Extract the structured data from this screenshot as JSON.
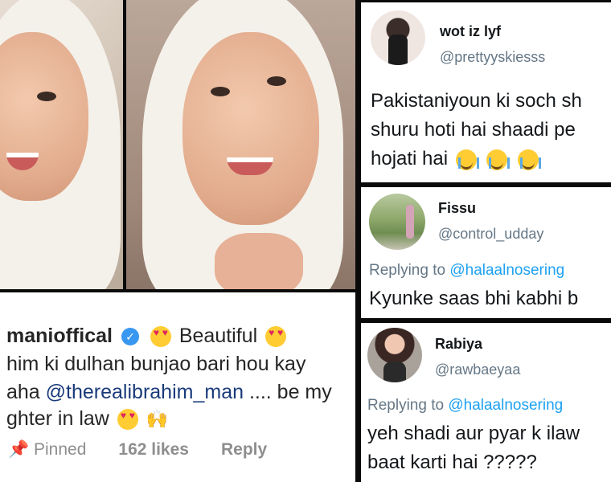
{
  "instagram_comment": {
    "username": "manioffical",
    "text_line1_suffix": "Beautiful",
    "text_line2": "him ki dulhan bunjao bari hou kay",
    "text_line3_prefix": "aha",
    "mention": "@therealibrahim_man",
    "text_line3_suffix": ".... be my",
    "text_line4": "ghter in law",
    "pinned_label": "Pinned",
    "likes_label": "162 likes",
    "reply_label": "Reply"
  },
  "tweets": [
    {
      "name": "wot iz lyf",
      "handle": "@prettyyskiesss",
      "replying_prefix": "",
      "replying_mention": "",
      "lines": [
        "Pakistaniyoun ki soch sh",
        "shuru hoti hai shaadi pe",
        "hojati hai"
      ]
    },
    {
      "name": "Fissu",
      "handle": "@control_udday",
      "replying_prefix": "Replying to",
      "replying_mention": "@halaalnosering",
      "lines": [
        "Kyunke saas bhi kabhi b"
      ]
    },
    {
      "name": "Rabiya",
      "handle": "@rawbaeyaa",
      "replying_prefix": "Replying to",
      "replying_mention": "@halaalnosering",
      "lines": [
        "yeh shadi aur pyar k ilaw",
        "baat karti hai ?????"
      ]
    }
  ],
  "icons": {
    "verified": "verified-badge-icon",
    "pin": "pin-icon",
    "heart_eyes": "heart-eyes-emoji-icon",
    "crying": "loudly-crying-emoji-icon",
    "raised_hands": "raised-hands-emoji-icon"
  },
  "colors": {
    "twitter_blue": "#1da1f2",
    "instagram_link": "#1a3b7a",
    "verified_blue": "#3897f0"
  }
}
